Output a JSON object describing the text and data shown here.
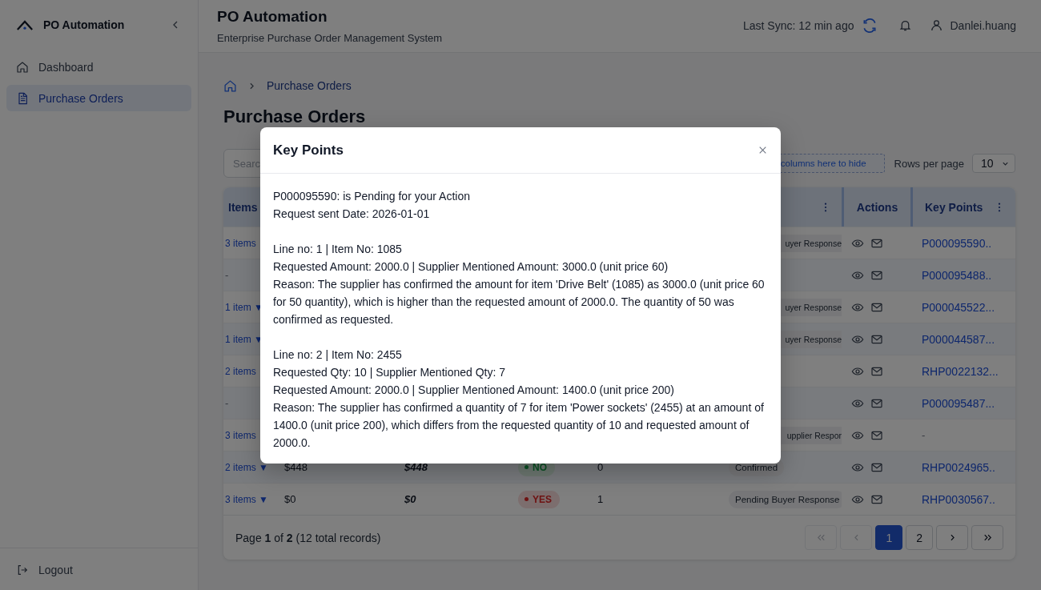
{
  "sidebar": {
    "brand": "PO Automation",
    "items": [
      {
        "label": "Dashboard",
        "selected": false
      },
      {
        "label": "Purchase Orders",
        "selected": true
      }
    ],
    "footer_item": "Logout"
  },
  "header": {
    "title": "PO Automation",
    "subtitle": "Enterprise Purchase Order Management System",
    "sync_text": "Last Sync: 12 min ago",
    "user": "Danlei.huang"
  },
  "breadcrumb": {
    "current": "Purchase Orders"
  },
  "page_title": "Purchase Orders",
  "toolbar": {
    "search_placeholder": "Searc",
    "drop_zone": "columns here to hide",
    "rows_label": "Rows per page",
    "rows_value": "10"
  },
  "table": {
    "columns": {
      "items": "Items",
      "actions": "Actions",
      "key_points": "Key Points"
    },
    "rows": [
      {
        "items": {
          "text": "3 items",
          "link": true
        },
        "status": {
          "text": "uyer Response",
          "kind": "clipped"
        },
        "key_point": {
          "text": "P000095590..",
          "link": true
        }
      },
      {
        "items": {
          "text": "-",
          "link": false
        },
        "key_point": {
          "text": "P000095488..",
          "link": true
        }
      },
      {
        "items": {
          "text": "1 item",
          "link": true,
          "caret": "▼"
        },
        "status": {
          "text": "uyer Response",
          "kind": "clipped"
        },
        "key_point": {
          "text": "P000045522...",
          "link": true
        }
      },
      {
        "items": {
          "text": "1 item",
          "link": true,
          "caret": "▼"
        },
        "status": {
          "text": "uyer Response",
          "kind": "clipped"
        },
        "key_point": {
          "text": "P000044587...",
          "link": true
        }
      },
      {
        "items": {
          "text": "2 items",
          "link": true
        },
        "key_point": {
          "text": "RHP0022132...",
          "link": true
        }
      },
      {
        "items": {
          "text": "-",
          "link": false
        },
        "key_point": {
          "text": "P000095487...",
          "link": true
        }
      },
      {
        "items": {
          "text": "3 items",
          "link": true
        },
        "status": {
          "text": "upplier Respor",
          "kind": "clipped"
        },
        "key_point": {
          "text": "-",
          "link": false
        }
      },
      {
        "items": {
          "text": "2 items",
          "link": true,
          "caret": "▼"
        },
        "amount": "$448",
        "total": "$448",
        "flag": {
          "text": "NO",
          "kind": "negative"
        },
        "count": "0",
        "status": {
          "text": "Confirmed",
          "kind": "full"
        },
        "key_point": {
          "text": "RHP0024965..",
          "link": true
        }
      },
      {
        "items": {
          "text": "3 items",
          "link": true,
          "caret": "▼"
        },
        "amount": "$0",
        "total": "$0",
        "flag": {
          "text": "YES",
          "kind": "positive"
        },
        "count": "1",
        "status": {
          "text": "Pending Buyer Response",
          "kind": "full"
        },
        "key_point": {
          "text": "RHP0030567..",
          "link": true
        }
      }
    ]
  },
  "pagination": {
    "summary": "Page **1** of **2** (12 total records)",
    "buttons": [
      {
        "kind": "first",
        "disabled": true
      },
      {
        "kind": "prev",
        "disabled": true
      },
      {
        "kind": "page",
        "label": "1",
        "selected": true
      },
      {
        "kind": "page",
        "label": "2",
        "selected": false
      },
      {
        "kind": "next",
        "disabled": false
      },
      {
        "kind": "last",
        "disabled": false
      }
    ]
  },
  "modal": {
    "title": "Key Points",
    "blocks": [
      [
        "P000095590: is Pending for your Action",
        "Request sent Date: 2026-01-01"
      ],
      [
        "Line no: 1 | Item No: 1085",
        "Requested Amount: 2000.0 | Supplier Mentioned Amount: 3000.0 (unit price 60)",
        "Reason: The supplier has confirmed the amount for item 'Drive Belt' (1085) as 3000.0 (unit price 60 for 50 quantity), which is higher than the requested amount of 2000.0. The quantity of 50 was confirmed as requested."
      ],
      [
        "Line no: 2 | Item No: 2455",
        "Requested Qty: 10 | Supplier Mentioned Qty: 7",
        "Requested Amount: 2000.0 | Supplier Mentioned Amount: 1400.0 (unit price 200)",
        "Reason: The supplier has confirmed a quantity of 7 for item 'Power sockets' (2455) at an amount of 1400.0 (unit price 200), which differs from the requested quantity of 10 and requested amount of 2000.0."
      ]
    ]
  }
}
